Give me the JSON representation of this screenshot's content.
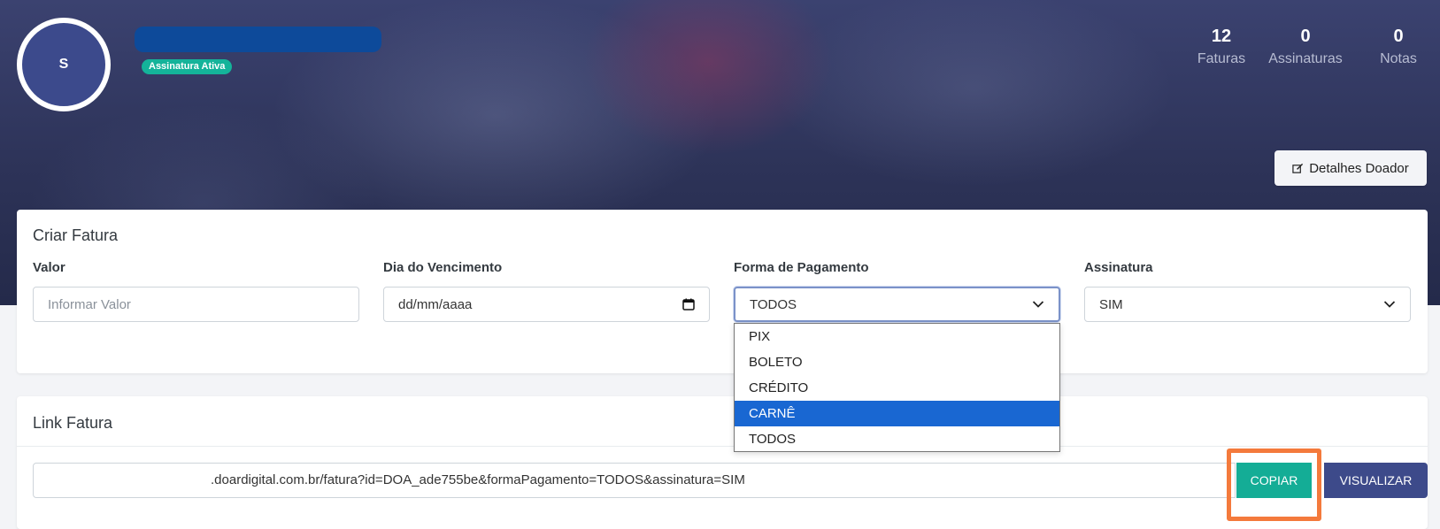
{
  "header": {
    "avatar_initial": "S",
    "status_badge": "Assinatura Ativa",
    "stats": [
      {
        "value": "12",
        "label": "Faturas"
      },
      {
        "value": "0",
        "label": "Assinaturas"
      },
      {
        "value": "0",
        "label": "Notas"
      }
    ],
    "details_button": "Detalhes Doador"
  },
  "criar_fatura": {
    "title": "Criar Fatura",
    "valor": {
      "label": "Valor",
      "placeholder": "Informar Valor"
    },
    "vencimento": {
      "label": "Dia do Vencimento",
      "value": "dd/mm/aaaa"
    },
    "forma_pagamento": {
      "label": "Forma de Pagamento",
      "value": "TODOS",
      "options": [
        "PIX",
        "BOLETO",
        "CRÉDITO",
        "CARNÊ",
        "TODOS"
      ],
      "highlighted": "CARNÊ"
    },
    "assinatura": {
      "label": "Assinatura",
      "value": "SIM"
    }
  },
  "link_fatura": {
    "title": "Link Fatura",
    "url": ".doardigital.com.br/fatura?id=DOA_ade755be&formaPagamento=TODOS&assinatura=SIM",
    "copy_button": "COPIAR",
    "view_button": "VISUALIZAR"
  },
  "colors": {
    "accent_teal": "#14ad96",
    "accent_navy": "#3d4a8a",
    "highlight_orange": "#f47a3c",
    "selected_option": "#1967d2"
  }
}
